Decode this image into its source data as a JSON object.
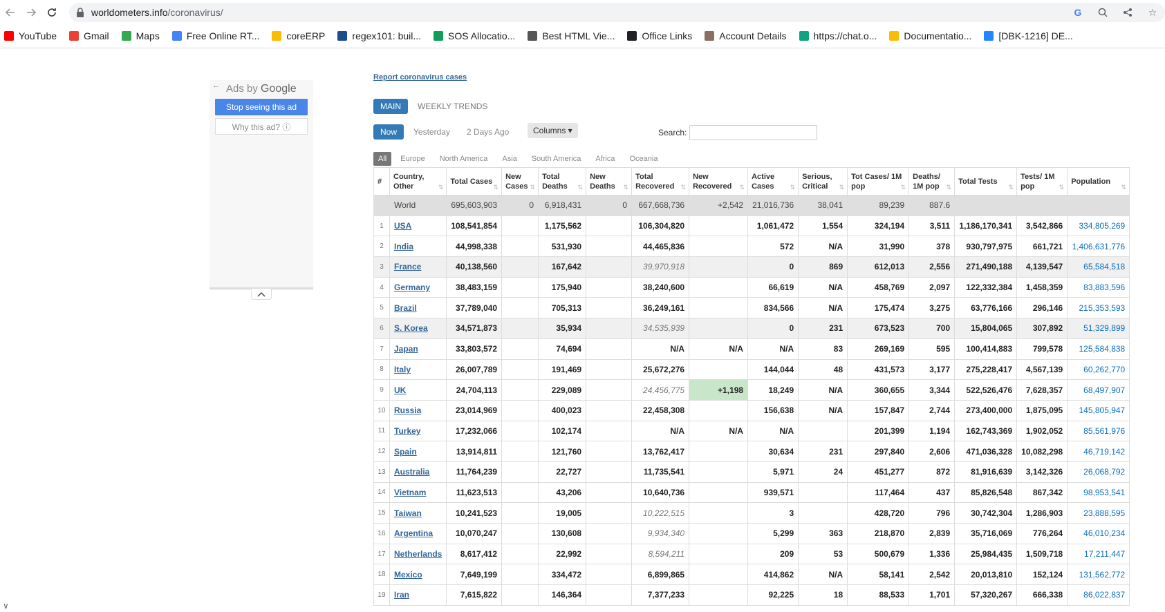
{
  "browser": {
    "url_host": "worldometers.info",
    "url_path": "/coronavirus/",
    "bookmarks": [
      {
        "label": "YouTube",
        "icon": "youtube-icon",
        "color": "#ff0000"
      },
      {
        "label": "Gmail",
        "icon": "gmail-icon",
        "color": "#ea4335"
      },
      {
        "label": "Maps",
        "icon": "maps-icon",
        "color": "#34a853"
      },
      {
        "label": "Free Online RT...",
        "icon": "rt-icon",
        "color": "#4285f4"
      },
      {
        "label": "coreERP",
        "icon": "coreerp-icon",
        "color": "#fbbc05"
      },
      {
        "label": "regex101: buil...",
        "icon": "regex-icon",
        "color": "#1e4d8c"
      },
      {
        "label": "SOS Allocatio...",
        "icon": "sos-icon",
        "color": "#0f9d58"
      },
      {
        "label": "Best HTML Vie...",
        "icon": "cb-icon",
        "color": "#555555"
      },
      {
        "label": "Office Links",
        "icon": "github-icon",
        "color": "#202124"
      },
      {
        "label": "Account Details",
        "icon": "account-icon",
        "color": "#8d6e63"
      },
      {
        "label": "https://chat.o...",
        "icon": "openai-icon",
        "color": "#10a37f"
      },
      {
        "label": "Documentatio...",
        "icon": "drive-icon",
        "color": "#fbbc05"
      },
      {
        "label": "[DBK-1216] DE...",
        "icon": "jira-icon",
        "color": "#2684ff"
      }
    ]
  },
  "ad": {
    "ads_by": "Ads by",
    "brand": "Google",
    "stop_label": "Stop seeing this ad",
    "why_label": "Why this ad? ⓘ"
  },
  "page": {
    "report_link": "Report coronavirus cases",
    "tab_main": "MAIN",
    "tab_weekly": "WEEKLY TRENDS",
    "day_now": "Now",
    "day_yesterday": "Yesterday",
    "day_2days": "2 Days Ago",
    "columns_label": "Columns ▾",
    "search_label": "Search:",
    "regions": [
      "All",
      "Europe",
      "North America",
      "Asia",
      "South America",
      "Africa",
      "Oceania"
    ]
  },
  "table": {
    "headers": [
      "#",
      "Country, Other",
      "Total Cases",
      "New Cases",
      "Total Deaths",
      "New Deaths",
      "Total Recovered",
      "New Recovered",
      "Active Cases",
      "Serious, Critical",
      "Tot Cases/ 1M pop",
      "Deaths/ 1M pop",
      "Total Tests",
      "Tests/ 1M pop",
      "Population"
    ],
    "world": [
      "",
      "World",
      "695,603,903",
      "0",
      "6,918,431",
      "0",
      "667,668,736",
      "+2,542",
      "21,016,736",
      "38,041",
      "89,239",
      "887.6",
      "",
      "",
      ""
    ],
    "rows": [
      [
        "1",
        "USA",
        "108,541,854",
        "",
        "1,175,562",
        "",
        "106,304,820",
        "",
        "1,061,472",
        "1,554",
        "324,194",
        "3,511",
        "1,186,170,341",
        "3,542,866",
        "334,805,269"
      ],
      [
        "2",
        "India",
        "44,998,338",
        "",
        "531,930",
        "",
        "44,465,836",
        "",
        "572",
        "N/A",
        "31,990",
        "378",
        "930,797,975",
        "661,721",
        "1,406,631,776"
      ],
      [
        "3",
        "France",
        "40,138,560",
        "",
        "167,642",
        "",
        "39,970,918",
        "",
        "0",
        "869",
        "612,013",
        "2,556",
        "271,490,188",
        "4,139,547",
        "65,584,518"
      ],
      [
        "4",
        "Germany",
        "38,483,159",
        "",
        "175,940",
        "",
        "38,240,600",
        "",
        "66,619",
        "N/A",
        "458,769",
        "2,097",
        "122,332,384",
        "1,458,359",
        "83,883,596"
      ],
      [
        "5",
        "Brazil",
        "37,789,040",
        "",
        "705,313",
        "",
        "36,249,161",
        "",
        "834,566",
        "N/A",
        "175,474",
        "3,275",
        "63,776,166",
        "296,146",
        "215,353,593"
      ],
      [
        "6",
        "S. Korea",
        "34,571,873",
        "",
        "35,934",
        "",
        "34,535,939",
        "",
        "0",
        "231",
        "673,523",
        "700",
        "15,804,065",
        "307,892",
        "51,329,899"
      ],
      [
        "7",
        "Japan",
        "33,803,572",
        "",
        "74,694",
        "",
        "N/A",
        "N/A",
        "N/A",
        "83",
        "269,169",
        "595",
        "100,414,883",
        "799,578",
        "125,584,838"
      ],
      [
        "8",
        "Italy",
        "26,007,789",
        "",
        "191,469",
        "",
        "25,672,276",
        "",
        "144,044",
        "48",
        "431,573",
        "3,177",
        "275,228,417",
        "4,567,139",
        "60,262,770"
      ],
      [
        "9",
        "UK",
        "24,704,113",
        "",
        "229,089",
        "",
        "24,456,775",
        "+1,198",
        "18,249",
        "N/A",
        "360,655",
        "3,344",
        "522,526,476",
        "7,628,357",
        "68,497,907"
      ],
      [
        "10",
        "Russia",
        "23,014,969",
        "",
        "400,023",
        "",
        "22,458,308",
        "",
        "156,638",
        "N/A",
        "157,847",
        "2,744",
        "273,400,000",
        "1,875,095",
        "145,805,947"
      ],
      [
        "11",
        "Turkey",
        "17,232,066",
        "",
        "102,174",
        "",
        "N/A",
        "N/A",
        "N/A",
        "",
        "201,399",
        "1,194",
        "162,743,369",
        "1,902,052",
        "85,561,976"
      ],
      [
        "12",
        "Spain",
        "13,914,811",
        "",
        "121,760",
        "",
        "13,762,417",
        "",
        "30,634",
        "231",
        "297,840",
        "2,606",
        "471,036,328",
        "10,082,298",
        "46,719,142"
      ],
      [
        "13",
        "Australia",
        "11,764,239",
        "",
        "22,727",
        "",
        "11,735,541",
        "",
        "5,971",
        "24",
        "451,277",
        "872",
        "81,916,639",
        "3,142,326",
        "26,068,792"
      ],
      [
        "14",
        "Vietnam",
        "11,623,513",
        "",
        "43,206",
        "",
        "10,640,736",
        "",
        "939,571",
        "",
        "117,464",
        "437",
        "85,826,548",
        "867,342",
        "98,953,541"
      ],
      [
        "15",
        "Taiwan",
        "10,241,523",
        "",
        "19,005",
        "",
        "10,222,515",
        "",
        "3",
        "",
        "428,720",
        "796",
        "30,742,304",
        "1,286,903",
        "23,888,595"
      ],
      [
        "16",
        "Argentina",
        "10,070,247",
        "",
        "130,608",
        "",
        "9,934,340",
        "",
        "5,299",
        "363",
        "218,870",
        "2,839",
        "35,716,069",
        "776,264",
        "46,010,234"
      ],
      [
        "17",
        "Netherlands",
        "8,617,412",
        "",
        "22,992",
        "",
        "8,594,211",
        "",
        "209",
        "53",
        "500,679",
        "1,336",
        "25,984,435",
        "1,509,718",
        "17,211,447"
      ],
      [
        "18",
        "Mexico",
        "7,649,199",
        "",
        "334,472",
        "",
        "6,899,865",
        "",
        "414,862",
        "N/A",
        "58,141",
        "2,542",
        "20,013,810",
        "152,124",
        "131,562,772"
      ],
      [
        "19",
        "Iran",
        "7,615,822",
        "",
        "146,364",
        "",
        "7,377,233",
        "",
        "92,225",
        "18",
        "88,533",
        "1,701",
        "57,320,267",
        "666,338",
        "86,022,837"
      ]
    ],
    "gray_rows": [
      3,
      6
    ],
    "italic_recovered_rows": [
      3,
      6,
      9,
      15,
      16,
      17
    ],
    "green_new_recovered_rows": [
      9
    ]
  }
}
